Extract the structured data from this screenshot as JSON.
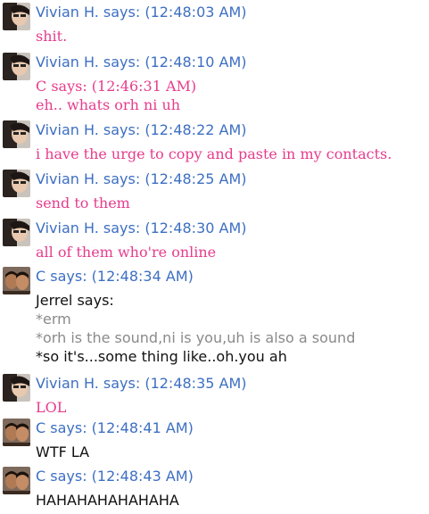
{
  "colors": {
    "header": "#3d6fc2",
    "vivian_text": "#e63c8c",
    "c_text": "#111111",
    "quoted_text": "#8a8a8a"
  },
  "messages": [
    {
      "sender": "Vivian H.",
      "time": "(12:48:03 AM)",
      "header": "Vivian H. says: (12:48:03 AM)",
      "avatar": "vivian-avatar",
      "lines": [
        "shit."
      ]
    },
    {
      "sender": "Vivian H.",
      "time": "(12:48:10 AM)",
      "header": "Vivian H. says: (12:48:10 AM)",
      "avatar": "vivian-avatar",
      "lines": [
        "C says: (12:46:31 AM)",
        "eh.. whats orh ni uh"
      ]
    },
    {
      "sender": "Vivian H.",
      "time": "(12:48:22 AM)",
      "header": "Vivian H. says: (12:48:22 AM)",
      "avatar": "vivian-avatar",
      "lines": [
        "i have the urge to copy and paste in my contacts."
      ]
    },
    {
      "sender": "Vivian H.",
      "time": "(12:48:25 AM)",
      "header": "Vivian H. says: (12:48:25 AM)",
      "avatar": "vivian-avatar",
      "lines": [
        "send to them"
      ]
    },
    {
      "sender": "Vivian H.",
      "time": "(12:48:30 AM)",
      "header": "Vivian H. says: (12:48:30 AM)",
      "avatar": "vivian-avatar",
      "lines": [
        "all of them who're online"
      ]
    },
    {
      "sender": "C",
      "time": "(12:48:34 AM)",
      "header": "C says: (12:48:34 AM)",
      "avatar": "c-avatar",
      "lines": [
        "Jerrel says:",
        "*erm",
        "*orh is the sound,ni is you,uh is also a sound",
        "*so it's...some thing like..oh.you ah"
      ]
    },
    {
      "sender": "Vivian H.",
      "time": "(12:48:35 AM)",
      "header": "Vivian H. says: (12:48:35 AM)",
      "avatar": "vivian-avatar",
      "lines": [
        "LOL"
      ]
    },
    {
      "sender": "C",
      "time": "(12:48:41 AM)",
      "header": "C says: (12:48:41 AM)",
      "avatar": "c-avatar",
      "lines": [
        "WTF LA"
      ]
    },
    {
      "sender": "C",
      "time": "(12:48:43 AM)",
      "header": "C says: (12:48:43 AM)",
      "avatar": "c-avatar",
      "lines": [
        "HAHAHAHAHAHAHA"
      ]
    }
  ]
}
